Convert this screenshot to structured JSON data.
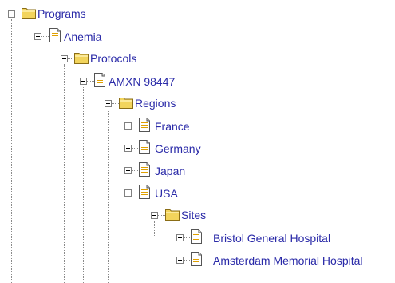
{
  "tree": {
    "nodes": [
      {
        "label": "Programs",
        "icon": "folder-icon",
        "toggle": "collapse"
      },
      {
        "label": "Anemia",
        "icon": "document-icon",
        "toggle": "collapse"
      },
      {
        "label": "Protocols",
        "icon": "folder-icon",
        "toggle": "collapse"
      },
      {
        "label": "AMXN 98447",
        "icon": "document-icon",
        "toggle": "collapse"
      },
      {
        "label": "Regions",
        "icon": "folder-icon",
        "toggle": "collapse"
      },
      {
        "label": "France",
        "icon": "document-icon",
        "toggle": "expand"
      },
      {
        "label": "Germany",
        "icon": "document-icon",
        "toggle": "expand"
      },
      {
        "label": "Japan",
        "icon": "document-icon",
        "toggle": "expand"
      },
      {
        "label": "USA",
        "icon": "document-icon",
        "toggle": "collapse"
      },
      {
        "label": "Sites",
        "icon": "folder-icon",
        "toggle": "collapse"
      },
      {
        "label": "Bristol General Hospital",
        "icon": "document-icon",
        "toggle": "expand"
      },
      {
        "label": "Amsterdam Memorial Hospital",
        "icon": "document-icon",
        "toggle": "expand"
      }
    ]
  },
  "colors": {
    "link_text": "#2a2aa8",
    "folder": "#f2d45c",
    "connector": "#8a8a8a"
  }
}
